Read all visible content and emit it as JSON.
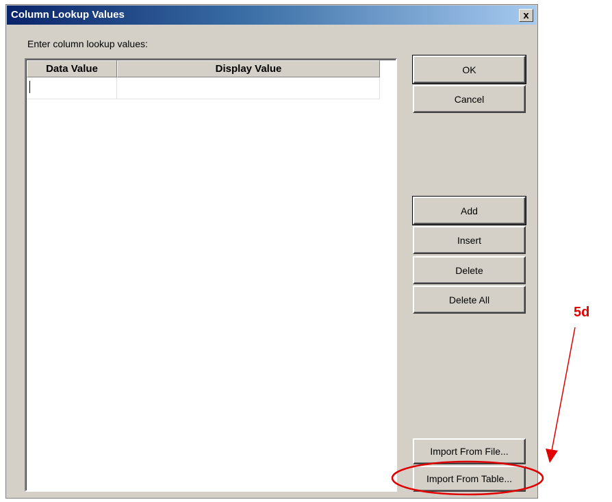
{
  "dialog": {
    "title": "Column Lookup Values",
    "close_symbol": "x",
    "prompt": "Enter column lookup values:"
  },
  "grid": {
    "columns": [
      "Data Value",
      "Display Value"
    ],
    "rows": [
      [
        "",
        ""
      ]
    ]
  },
  "buttons": {
    "ok": "OK",
    "cancel": "Cancel",
    "add": "Add",
    "insert": "Insert",
    "delete": "Delete",
    "delete_all": "Delete All",
    "import_file": "Import From File...",
    "import_table": "Import From Table..."
  },
  "annotation": {
    "label": "5d",
    "color": "#e00000"
  }
}
